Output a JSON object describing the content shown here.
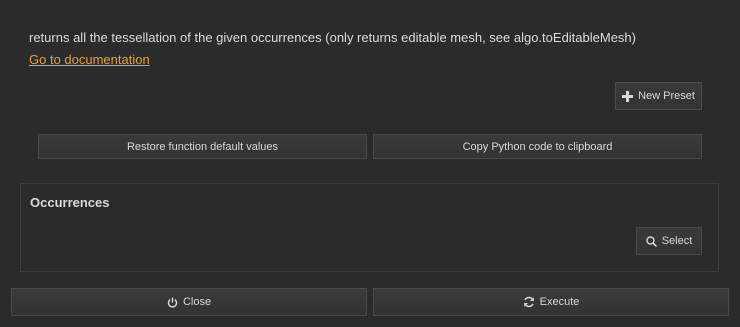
{
  "description": "returns all the tessellation of the given occurrences (only returns editable mesh, see algo.toEditableMesh)",
  "doc_link": "Go to documentation",
  "preset": {
    "new_preset_label": "New Preset",
    "icon": "plus-icon"
  },
  "actions": {
    "restore_label": "Restore function default values",
    "copy_label": "Copy Python code to clipboard"
  },
  "occurrences": {
    "title": "Occurrences",
    "select_label": "Select",
    "select_icon": "search-icon"
  },
  "footer": {
    "close_label": "Close",
    "close_icon": "power-icon",
    "execute_label": "Execute",
    "execute_icon": "refresh-icon"
  },
  "colors": {
    "background": "#2b2b2b",
    "link": "#f0a020",
    "text": "#d8d8d8"
  }
}
